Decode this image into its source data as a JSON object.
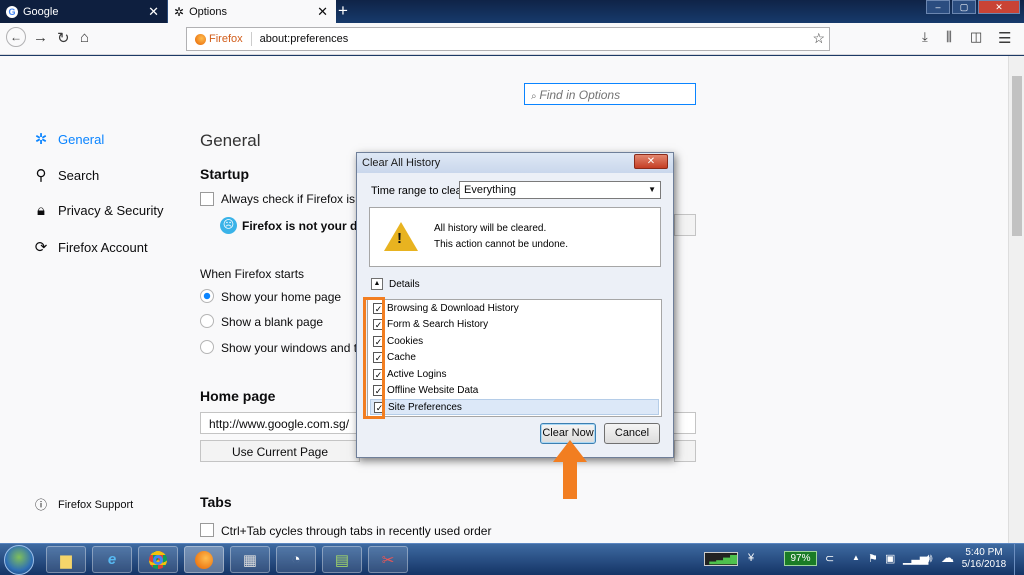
{
  "tabs": [
    {
      "title": "Google",
      "icon": "google-icon",
      "active": false
    },
    {
      "title": "Options",
      "icon": "gear-icon",
      "active": true
    }
  ],
  "urlbar": {
    "identity": "Firefox",
    "url": "about:preferences"
  },
  "search": {
    "placeholder": "Find in Options"
  },
  "sidebar": [
    {
      "label": "General",
      "icon": "gear-icon",
      "selected": true
    },
    {
      "label": "Search",
      "icon": "search-icon"
    },
    {
      "label": "Privacy & Security",
      "icon": "lock-icon"
    },
    {
      "label": "Firefox Account",
      "icon": "sync-icon"
    }
  ],
  "support_link": "Firefox Support",
  "main": {
    "title": "General",
    "startup_heading": "Startup",
    "always_check": "Always check if Firefox is yo",
    "not_default": "Firefox is not your def",
    "when_starts": "When Firefox starts",
    "radio_options": [
      "Show your home page",
      "Show a blank page",
      "Show your windows and tab"
    ],
    "home_heading": "Home page",
    "home_url": "http://www.google.com.sg/",
    "use_current": "Use Current Page",
    "tabs_heading": "Tabs",
    "ctrl_tab": "Ctrl+Tab cycles through tabs in recently used order"
  },
  "dialog": {
    "title": "Clear All History",
    "time_range_label": "Time range to clear:",
    "time_range_value": "Everything",
    "warning_line1": "All history will be cleared.",
    "warning_line2": "This action cannot be undone.",
    "details_label": "Details",
    "items": [
      {
        "label": "Browsing & Download History",
        "checked": true
      },
      {
        "label": "Form & Search History",
        "checked": true
      },
      {
        "label": "Cookies",
        "checked": true
      },
      {
        "label": "Cache",
        "checked": true
      },
      {
        "label": "Active Logins",
        "checked": true
      },
      {
        "label": "Offline Website Data",
        "checked": true
      },
      {
        "label": "Site Preferences",
        "checked": true
      }
    ],
    "clear_now": "Clear Now",
    "cancel": "Cancel"
  },
  "taskbar": {
    "battery": "97%",
    "time": "5:40 PM",
    "date": "5/16/2018"
  },
  "colors": {
    "accent": "#0a84ff",
    "annotation": "#f27e21"
  }
}
